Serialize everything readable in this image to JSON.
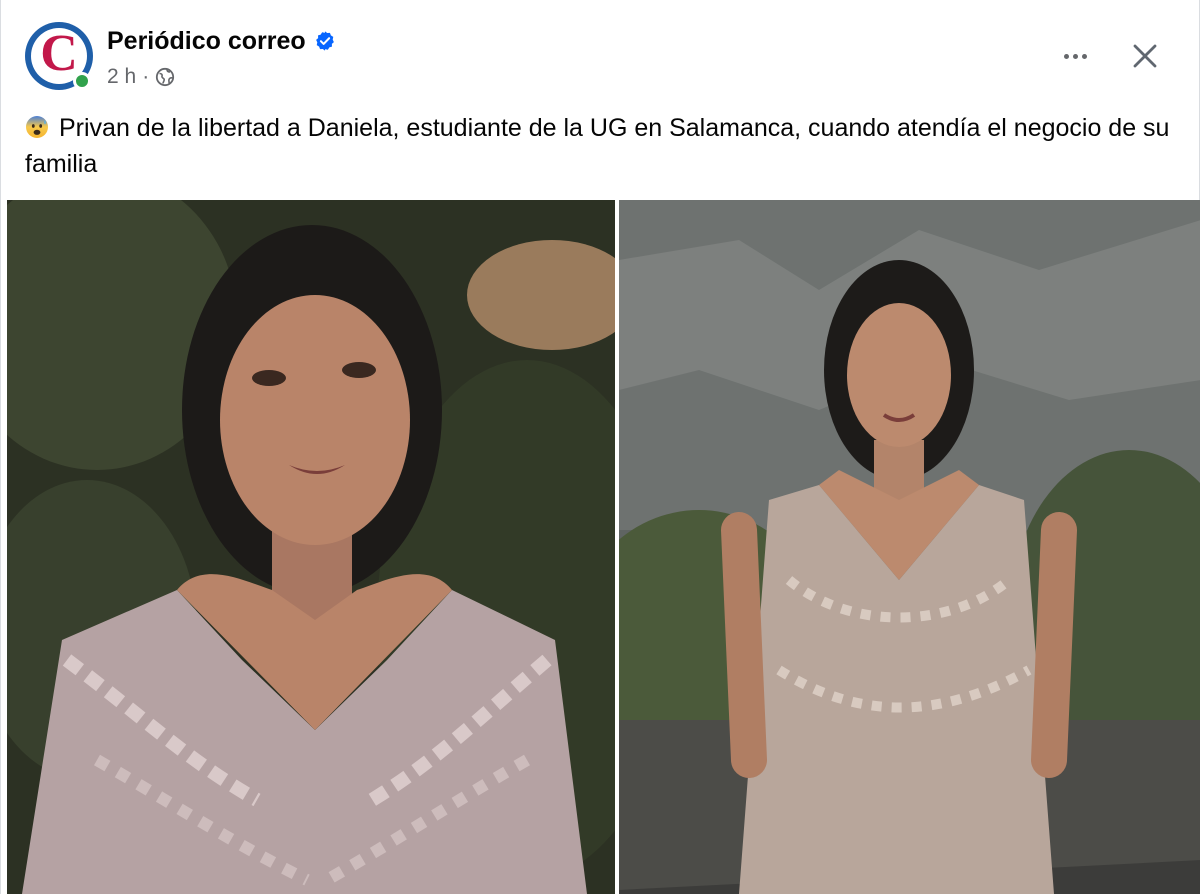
{
  "post": {
    "page_name": "Periódico correo",
    "avatar_letter": "C",
    "verified_icon": "verified-badge-icon",
    "time": "2 h",
    "separator": "·",
    "audience_icon": "globe-icon",
    "text": "Privan de la libertad a Daniela, estudiante de la UG en Salamanca, cuando atendía el negocio de su familia",
    "text_emoji_icon": "anxious-face-emoji-icon",
    "more_icon": "more-options-icon",
    "close_icon": "close-icon"
  },
  "colors": {
    "brand_blue": "#1f5fa9",
    "brand_red": "#c2184a",
    "verified_blue": "#0866ff",
    "online_green": "#31a24c",
    "secondary_text": "#65676b"
  },
  "photos": [
    {
      "description_icon": "photo-woman-portrait-closeup"
    },
    {
      "description_icon": "photo-woman-standing-dress"
    }
  ]
}
